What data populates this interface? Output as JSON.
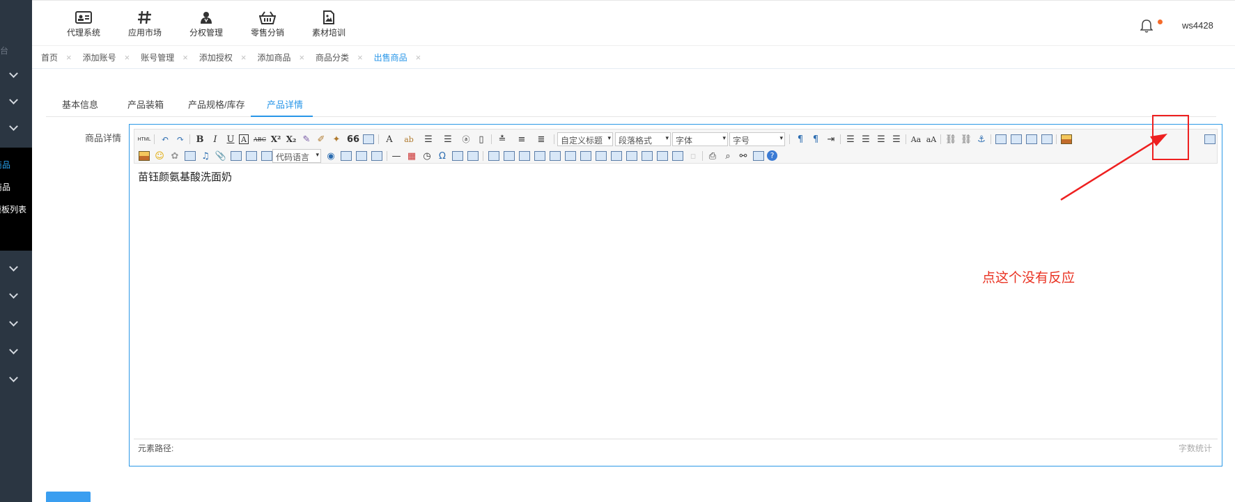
{
  "sidebar": {
    "partial_title": "台",
    "sub_items": [
      "商品",
      "商品",
      "模板列表"
    ]
  },
  "topnav": {
    "items": [
      {
        "label": "代理系统",
        "icon": "id-card-icon"
      },
      {
        "label": "应用市场",
        "icon": "grid-icon"
      },
      {
        "label": "分权管理",
        "icon": "user-group-icon"
      },
      {
        "label": "零售分销",
        "icon": "basket-icon"
      },
      {
        "label": "素材培训",
        "icon": "image-file-icon"
      }
    ],
    "username": "ws4428"
  },
  "breadcrumbs": [
    {
      "label": "首页",
      "close": "×"
    },
    {
      "label": "添加账号",
      "close": "×"
    },
    {
      "label": "账号管理",
      "close": "×"
    },
    {
      "label": "添加授权",
      "close": "×"
    },
    {
      "label": "添加商品",
      "close": "×"
    },
    {
      "label": "商品分类",
      "close": "×"
    },
    {
      "label": "出售商品",
      "close": "×"
    }
  ],
  "tabs": [
    "基本信息",
    "产品装箱",
    "产品规格/库存",
    "产品详情"
  ],
  "form": {
    "field_label": "商品详情"
  },
  "editor": {
    "dropdowns": {
      "custom_title": "自定义标题",
      "paragraph": "段落格式",
      "font": "字体",
      "font_size": "字号",
      "code_lang": "代码语言"
    },
    "text_buttons": {
      "html": "HTML",
      "bold": "B",
      "italic": "I",
      "underline": "U",
      "border": "A",
      "strike": "ABC",
      "superscript": "X²",
      "subscript": "X₂",
      "quote": "66",
      "font_color": "A",
      "omega": "Ω"
    },
    "content": "苗钰颜氨基酸洗面奶",
    "element_path": "元素路径:",
    "word_count": "字数统计"
  },
  "annotation": {
    "text": "点这个没有反应",
    "color": "#e93323"
  },
  "submit_button": "",
  "colors": {
    "accent": "#2896e8",
    "sidebar": "#2b3642"
  }
}
